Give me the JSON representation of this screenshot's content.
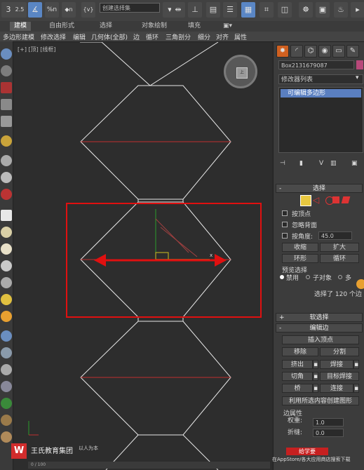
{
  "toolbar": {
    "snap_2_5": "2.5",
    "angle_snap": "∡",
    "percent_snap": "%n",
    "spinner_snap": "◆n",
    "edit_named_sel": "{v}",
    "selection_set_placeholder": "创建选择集"
  },
  "ribbon_tabs": [
    "建模",
    "自由形式",
    "选择",
    "对象绘制",
    "填充"
  ],
  "poly_menu": [
    "多边形建模",
    "修改选择",
    "编辑",
    "几何体(全部)",
    "边",
    "循环",
    "三角剖分",
    "细分",
    "对齐",
    "属性"
  ],
  "viewport": {
    "label": "[+] [顶] [线框]",
    "viewcube_face": "上"
  },
  "panel": {
    "object_name": "Box2131679087",
    "object_color": "#b8487a",
    "modifier_list": "修改器列表",
    "stack_item": "可编辑多边形",
    "selection": {
      "header": "选择",
      "by_vertex": "按顶点",
      "ignore_backfacing": "忽略背面",
      "by_angle": "按角度:",
      "angle_value": "45.0",
      "shrink": "收缩",
      "grow": "扩大",
      "ring": "环形",
      "loop": "循环",
      "preview_selection": "预览选择",
      "disabled": "禁用",
      "subobject": "子对象",
      "multi": "多",
      "status": "选择了 120 个边"
    },
    "soft_selection": "软选择",
    "edit_edges": {
      "header": "编辑边",
      "insert_vertex": "插入顶点",
      "remove": "移除",
      "split": "分割",
      "extrude": "挤出",
      "weld": "焊接",
      "chamfer": "切角",
      "target_weld": "目标焊接",
      "bridge": "桥",
      "connect": "连接",
      "create_shape": "利用所选内容创建图形",
      "edge_props": "边属性",
      "weight": "权重:",
      "weight_value": "1.0",
      "crease": "折缝:",
      "crease_value": "0.0"
    }
  },
  "bottom": {
    "logo": "W",
    "brand": "王氏教育集团",
    "slogan": "以人为本",
    "red_btn": "给学要",
    "appstore_text": "在AppStore/各大应用商店搜索下载",
    "timeline": "0 / 100"
  },
  "colors": {
    "accent_blue": "#5a86c4",
    "highlight_red": "#e01010",
    "wire_white": "#e8e8e8",
    "edge_red": "#c03030"
  }
}
